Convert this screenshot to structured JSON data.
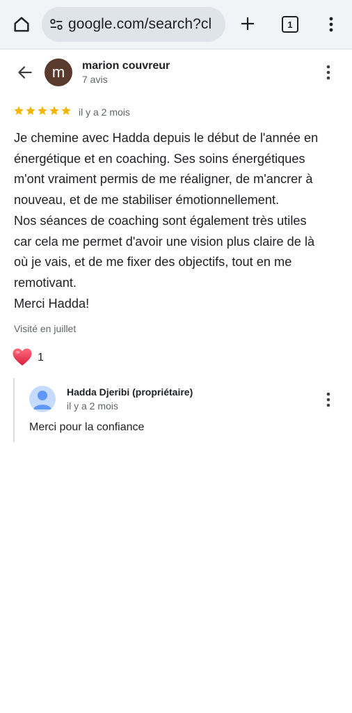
{
  "browser": {
    "url": "google.com/search?cl",
    "tab_count": "1",
    "icons": [
      "home-icon",
      "site-settings-icon",
      "new-tab-plus-icon",
      "tab-switcher-icon",
      "more-vert-icon"
    ]
  },
  "review": {
    "avatar_letter": "m",
    "reviewer_name": "marion couvreur",
    "reviewer_reviews": "7 avis",
    "rating": 5,
    "time": "il y a 2 mois",
    "body": "Je chemine avec Hadda depuis le début de l'année en\nénergétique et en coaching. Ses soins énergétiques\nm'ont vraiment permis de me réaligner, de m'ancrer à\nnouveau, et de me stabiliser émotionnellement.\nNos séances de coaching sont également très utiles\ncar cela me permet d'avoir une vision plus claire de là\noù je vais, et de me fixer des objectifs, tout en me\nremotivant.\nMerci Hadda!",
    "visited": "Visité en juillet",
    "likes": "1"
  },
  "reply": {
    "owner_name": "Hadda Djeribi (propriétaire)",
    "time": "il y a 2 mois",
    "text": "Merci pour la confiance"
  },
  "colors": {
    "star": "#f4b400",
    "heart": "#e8334a",
    "avatar": "#5b3a2e",
    "toolbar": "#f1f3f6"
  }
}
